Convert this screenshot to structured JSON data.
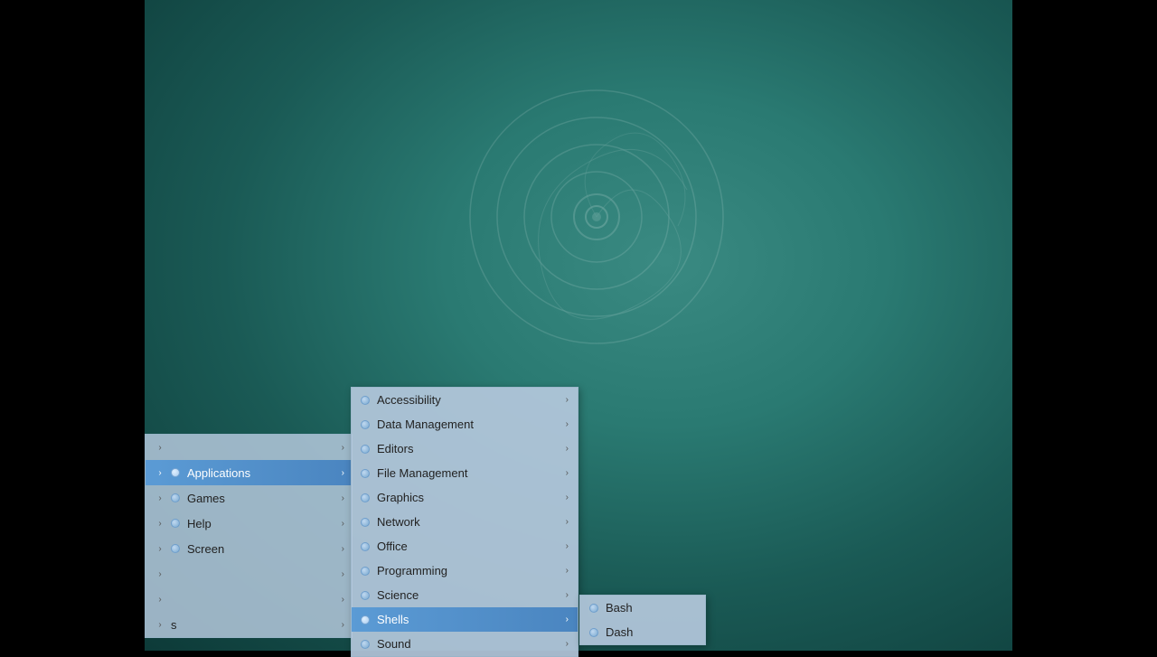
{
  "desktop": {
    "background_color": "#2a7a72"
  },
  "left_menu": {
    "items": [
      {
        "label": "",
        "has_left_arrow": true,
        "active": false,
        "partial": true
      },
      {
        "label": "Applications",
        "active": true
      },
      {
        "label": "Games",
        "active": false
      },
      {
        "label": "Help",
        "active": false
      },
      {
        "label": "Screen",
        "active": false
      },
      {
        "label": "",
        "has_left_arrow": true,
        "active": false
      },
      {
        "label": "",
        "has_left_arrow": true,
        "active": false
      },
      {
        "label": "",
        "has_left_arrow": true,
        "active": false,
        "partial": true
      }
    ]
  },
  "apps_menu": {
    "items": [
      {
        "label": "Accessibility",
        "has_submenu": true,
        "active": false
      },
      {
        "label": "Data Management",
        "has_submenu": true,
        "active": false
      },
      {
        "label": "Editors",
        "has_submenu": true,
        "active": false
      },
      {
        "label": "File Management",
        "has_submenu": true,
        "active": false
      },
      {
        "label": "Graphics",
        "has_submenu": true,
        "active": false
      },
      {
        "label": "Network",
        "has_submenu": true,
        "active": false
      },
      {
        "label": "Office",
        "has_submenu": true,
        "active": false
      },
      {
        "label": "Programming",
        "has_submenu": true,
        "active": false
      },
      {
        "label": "Science",
        "has_submenu": true,
        "active": false
      },
      {
        "label": "Shells",
        "has_submenu": true,
        "active": true
      },
      {
        "label": "Sound",
        "has_submenu": true,
        "active": false
      }
    ]
  },
  "shells_menu": {
    "items": [
      {
        "label": "Bash"
      },
      {
        "label": "Dash"
      }
    ]
  }
}
